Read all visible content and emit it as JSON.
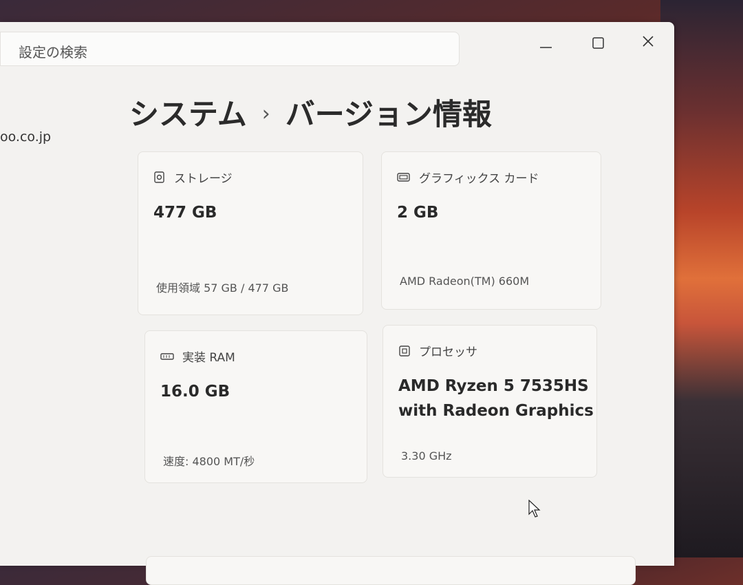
{
  "search": {
    "placeholder": "設定の検索"
  },
  "account": {
    "email_fragment": "oo.co.jp"
  },
  "breadcrumb": {
    "parent": "システム",
    "separator": "›",
    "current": "バージョン情報"
  },
  "specs": {
    "storage": {
      "label": "ストレージ",
      "value": "477 GB",
      "detail": "使用領域 57 GB / 477 GB",
      "icon": "storage-icon"
    },
    "graphics": {
      "label": "グラフィックス カード",
      "value": "2 GB",
      "detail": "AMD Radeon(TM) 660M",
      "icon": "graphics-card-icon"
    },
    "ram": {
      "label": "実装 RAM",
      "value": "16.0 GB",
      "detail": "速度: 4800 MT/秒",
      "icon": "ram-icon"
    },
    "processor": {
      "label": "プロセッサ",
      "value_line1": "AMD Ryzen 5 7535HS",
      "value_line2": "with Radeon Graphics",
      "detail": "3.30 GHz",
      "icon": "processor-icon"
    }
  },
  "colors": {
    "window_bg": "#f3f2f0",
    "card_bg": "#f8f7f5",
    "text": "#2b2b2b"
  }
}
